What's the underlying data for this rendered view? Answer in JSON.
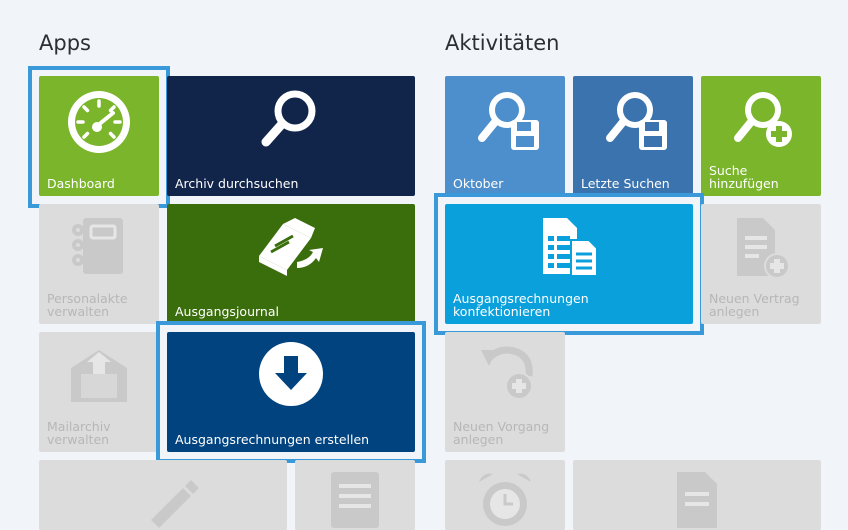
{
  "apps": {
    "heading": "Apps",
    "tiles": {
      "dashboard": "Dashboard",
      "archiv": "Archiv durchsuchen",
      "personalakte": "Personalakte verwalten",
      "ausgangsjournal": "Ausgangsjournal",
      "mailarchiv": "Mailarchiv verwalten",
      "ausgangsrechnungen_erstellen": "Ausgangsrechnungen erstellen"
    }
  },
  "activities": {
    "heading": "Aktivitäten",
    "tiles": {
      "oktober": "Oktober",
      "letzte_suchen": "Letzte Suchen",
      "suche_hinzufuegen": "Suche hinzufügen",
      "konfektionieren": "Ausgangsrechnungen konfektionieren",
      "neuer_vertrag": "Neuen Vertrag anlegen",
      "neuer_vorgang": "Neuen Vorgang anlegen"
    }
  },
  "colors": {
    "background": "#f1f5f9",
    "selection": "#3a9ad9",
    "green": "#7ab52c",
    "navy": "#11244a",
    "dark_green": "#3a6e0c",
    "dark_blue": "#00437f",
    "light_blue": "#4d8fcc",
    "mid_blue": "#3a73ad",
    "cyan": "#0aa0dc",
    "disabled": "#dcdcdc"
  }
}
